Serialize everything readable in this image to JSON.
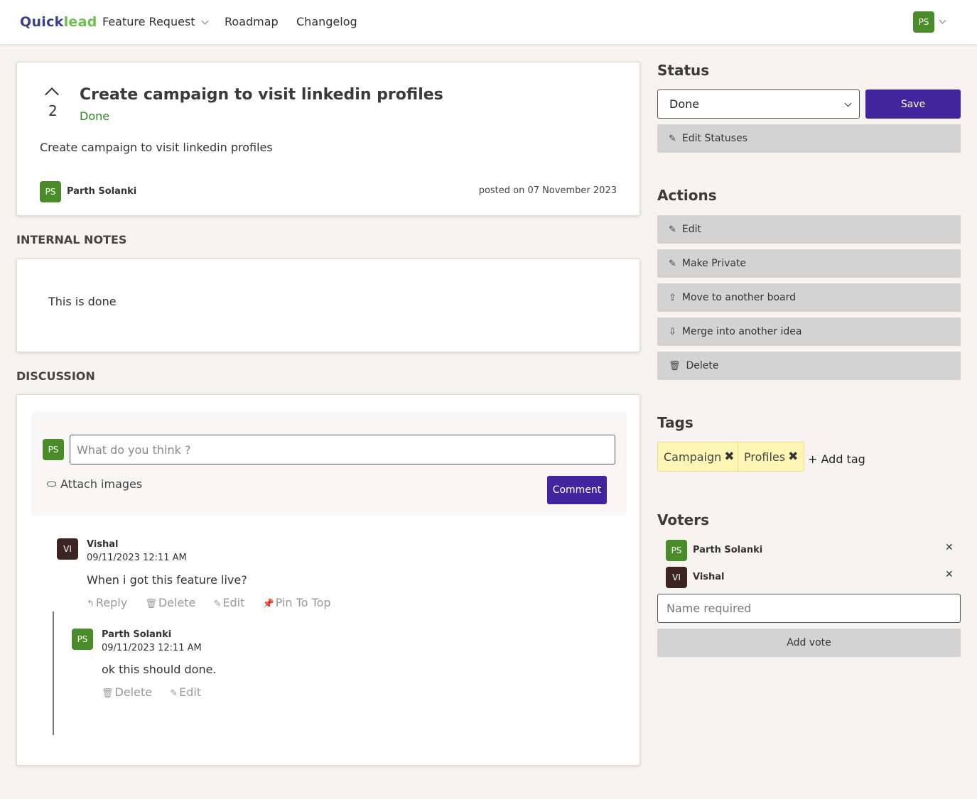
{
  "header": {
    "logo_part1": "Quick",
    "logo_part2": "lead",
    "nav": {
      "feature_request": "Feature Request",
      "roadmap": "Roadmap",
      "changelog": "Changelog"
    },
    "user_initials": "PS"
  },
  "post": {
    "vote_count": "2",
    "title": "Create campaign to visit linkedin profiles",
    "status": "Done",
    "body": "Create campaign to visit linkedin profiles",
    "author_initials": "PS",
    "author": "Parth Solanki",
    "posted": "posted on 07 November 2023"
  },
  "internal_notes": {
    "label": "INTERNAL NOTES",
    "text": "This is done"
  },
  "discussion": {
    "label": "DISCUSSION",
    "user_initials": "PS",
    "placeholder": "What do you think ?",
    "attach_label": "Attach images",
    "comment_button": "Comment",
    "comments": [
      {
        "initials": "VI",
        "name": "Vishal",
        "time": "09/11/2023 12:11 AM",
        "text": "When i got this feature live?",
        "actions": {
          "reply": "Reply",
          "delete": "Delete",
          "edit": "Edit",
          "pin": "Pin To Top"
        }
      },
      {
        "initials": "PS",
        "name": "Parth Solanki",
        "time": "09/11/2023 12:11 AM",
        "text": "ok this should done.",
        "actions": {
          "delete": "Delete",
          "edit": "Edit"
        }
      }
    ]
  },
  "sidebar": {
    "status": {
      "heading": "Status",
      "selected": "Done",
      "save_label": "Save",
      "edit_statuses": "Edit Statuses"
    },
    "actions": {
      "heading": "Actions",
      "items": [
        "Edit",
        "Make Private",
        "Move to another board",
        "Merge into another idea",
        "Delete"
      ]
    },
    "tags": {
      "heading": "Tags",
      "items": [
        "Campaign",
        "Profiles"
      ],
      "add_tag": "+ Add tag"
    },
    "voters": {
      "heading": "Voters",
      "items": [
        {
          "initials": "PS",
          "name": "Parth Solanki"
        },
        {
          "initials": "VI",
          "name": "Vishal"
        }
      ],
      "name_placeholder": "Name required",
      "add_vote": "Add vote"
    }
  },
  "colors": {
    "accent": "#42249e",
    "status_done": "#2e8b1f",
    "avatar_green": "#4a8c2a",
    "avatar_brown": "#3c2520",
    "tag_bg": "#fdf6b5"
  }
}
